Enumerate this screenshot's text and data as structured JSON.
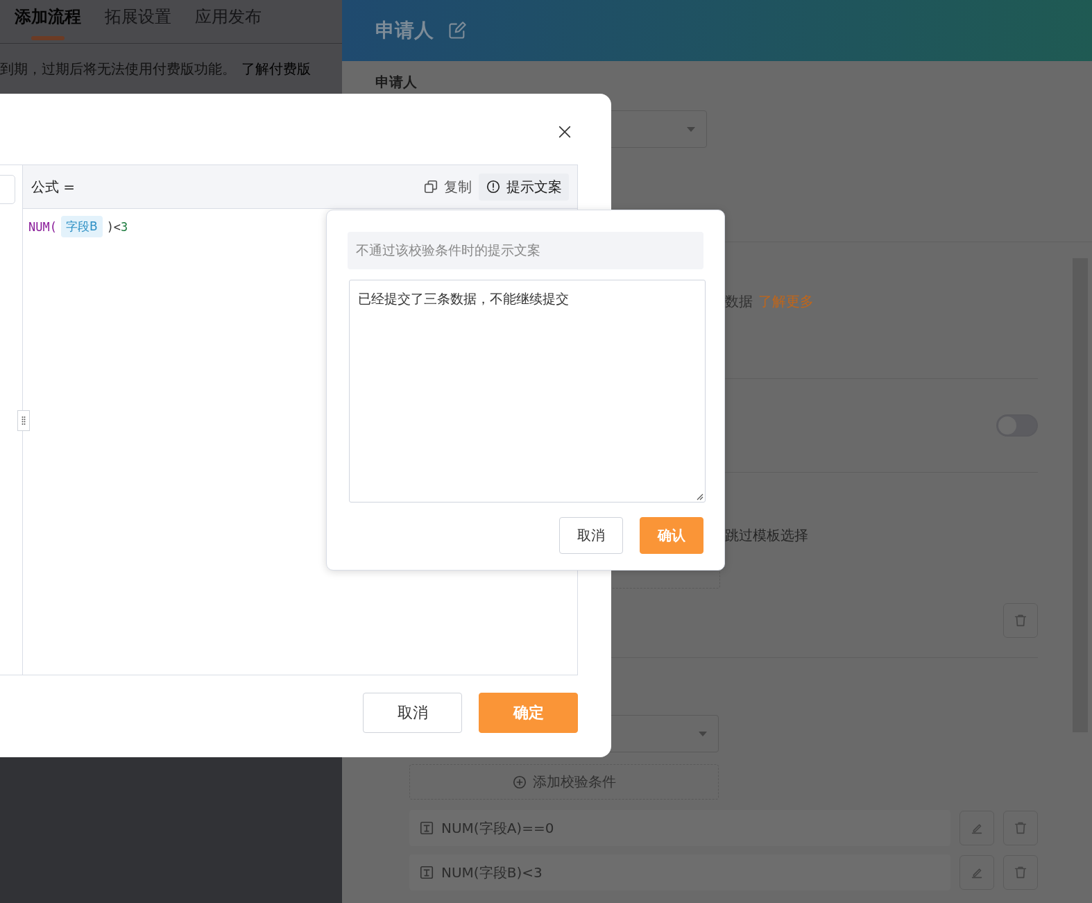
{
  "nav": {
    "tabs": [
      {
        "label": "添加流程",
        "selected": true
      },
      {
        "label": "拓展设置",
        "selected": false
      },
      {
        "label": "应用发布",
        "selected": false
      }
    ],
    "notice": {
      "text": "到期，过期后将无法使用付费版功能。",
      "link": "了解付费版"
    }
  },
  "panel": {
    "title": "申请人",
    "field_label": "申请人",
    "hint": {
      "text": "数据",
      "link": "了解更多"
    },
    "switch": {
      "on": false
    },
    "option_text": "跳过模板选择",
    "add_condition": "添加校验条件",
    "conditions": [
      {
        "text": "NUM(字段A)==0"
      },
      {
        "text": "NUM(字段B)<3"
      }
    ]
  },
  "formula_dialog": {
    "label": "公式 =",
    "actions": [
      {
        "label": "复制",
        "kind": "copy",
        "selected": false
      },
      {
        "label": "提示文案",
        "kind": "info",
        "selected": true
      }
    ],
    "tokens": [
      {
        "kind": "func",
        "text": "NUM("
      },
      {
        "kind": "field",
        "text": "字段B"
      },
      {
        "kind": "op",
        "text": ")<"
      },
      {
        "kind": "number",
        "text": "3"
      }
    ],
    "buttons": [
      {
        "label": "取消",
        "kind": "secondary"
      },
      {
        "label": "确定",
        "kind": "primary"
      }
    ]
  },
  "tip_popover": {
    "title": "不通过该校验条件时的提示文案",
    "message": "已经提交了三条数据，不能继续提交",
    "buttons": [
      {
        "label": "取消",
        "kind": "secondary"
      },
      {
        "label": "确认",
        "kind": "primary"
      }
    ]
  }
}
